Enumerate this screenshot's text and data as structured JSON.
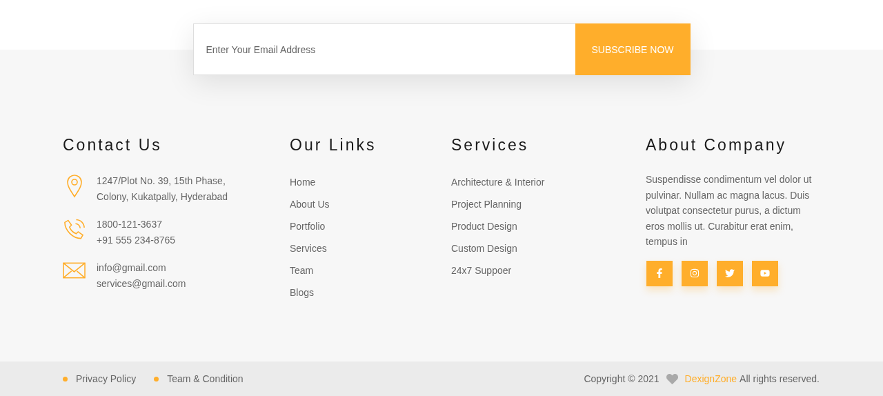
{
  "subscribe": {
    "placeholder": "Enter Your Email Address",
    "button": "SUBSCRIBE NOW"
  },
  "contact": {
    "title": "Contact Us",
    "items": [
      {
        "kind": "address",
        "lines": [
          "1247/Plot No. 39, 15th Phase,",
          "Colony, Kukatpally, Hyderabad"
        ]
      },
      {
        "kind": "phone",
        "lines": [
          "1800-121-3637",
          "+91 555 234-8765"
        ]
      },
      {
        "kind": "email",
        "lines": [
          "info@gmail.com",
          "services@gmail.com"
        ]
      }
    ]
  },
  "links": {
    "title": "Our Links",
    "items": [
      "Home",
      "About Us",
      "Portfolio",
      "Services",
      "Team",
      "Blogs"
    ]
  },
  "services": {
    "title": "Services",
    "items": [
      "Architecture & Interior",
      "Project Planning",
      "Product Design",
      "Custom Design",
      "24x7 Suppoer"
    ]
  },
  "about": {
    "title": "About Company",
    "text": "Suspendisse condimentum vel dolor ut pulvinar. Nullam ac magna lacus. Duis volutpat consectetur purus, a dictum eros mollis ut. Curabitur erat enim, tempus in",
    "social": [
      {
        "kind": "facebook"
      },
      {
        "kind": "instagram"
      },
      {
        "kind": "twitter"
      },
      {
        "kind": "youtube"
      }
    ]
  },
  "bottom": {
    "links": [
      "Privacy Policy",
      "Team & Condition"
    ],
    "copyright": {
      "prefix": "Copyright © 2021",
      "link": "DexignZone",
      "suffix": "All rights reserved."
    }
  }
}
